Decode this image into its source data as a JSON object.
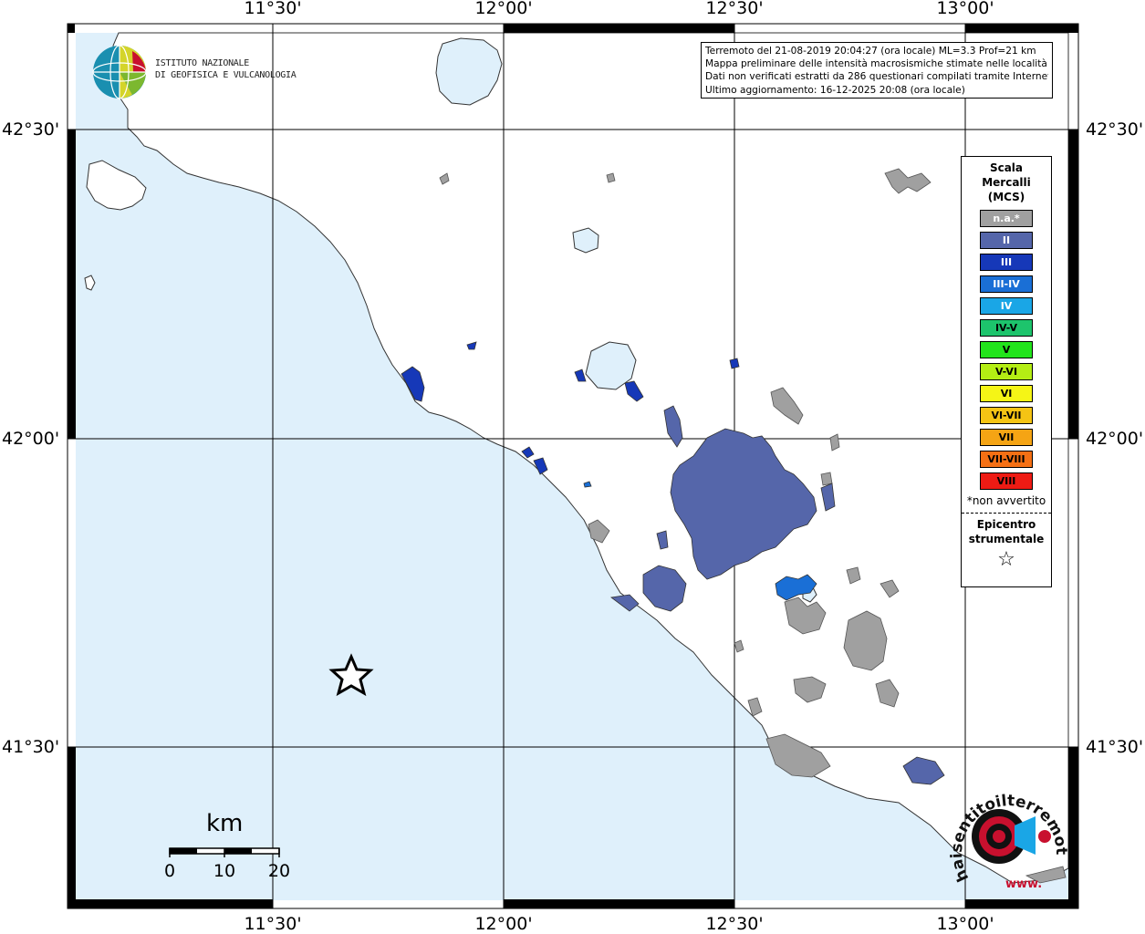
{
  "map": {
    "colors": {
      "sea": "#dff0fb",
      "land": "#ffffff",
      "coast": "#333333",
      "grid": "#000000",
      "na": "#a0a0a0",
      "II": "#5566aa"
    },
    "lon_labels": [
      "11°30'",
      "12°00'",
      "12°30'",
      "13°00'"
    ],
    "lat_labels": [
      "42°30'",
      "42°00'",
      "41°30'"
    ],
    "epicenter_icon": "star-icon"
  },
  "info": {
    "line1": "Terremoto del 21-08-2019 20:04:27 (ora locale) ML=3.3 Prof=21 km",
    "line2": "Mappa preliminare delle intensità macrosismiche stimate nelle località",
    "line3": "Dati non verificati estratti da 286 questionari compilati tramite Internet.",
    "line4": "Ultimo aggiornamento: 16-12-2025 20:08 (ora locale)"
  },
  "logo": {
    "line1": "ISTITUTO NAZIONALE",
    "line2": "DI GEOFISICA E VULCANOLOGIA"
  },
  "legend": {
    "title1": "Scala",
    "title2": "Mercalli",
    "title3": "(MCS)",
    "items": [
      {
        "label": "n.a.*",
        "color": "#a0a0a0",
        "text": "#ffffff"
      },
      {
        "label": "II",
        "color": "#5566aa",
        "text": "#ffffff"
      },
      {
        "label": "III",
        "color": "#1638b8",
        "text": "#ffffff"
      },
      {
        "label": "III-IV",
        "color": "#1a6fd6",
        "text": "#ffffff"
      },
      {
        "label": "IV",
        "color": "#1aa6e6",
        "text": "#ffffff"
      },
      {
        "label": "IV-V",
        "color": "#1dc46c",
        "text": "#000000"
      },
      {
        "label": "V",
        "color": "#22e41c",
        "text": "#000000"
      },
      {
        "label": "V-VI",
        "color": "#b4ee14",
        "text": "#000000"
      },
      {
        "label": "VI",
        "color": "#f5f516",
        "text": "#000000"
      },
      {
        "label": "VI-VII",
        "color": "#f5c414",
        "text": "#000000"
      },
      {
        "label": "VII",
        "color": "#f5a414",
        "text": "#000000"
      },
      {
        "label": "VII-VIII",
        "color": "#f57014",
        "text": "#000000"
      },
      {
        "label": "VIII",
        "color": "#ee1b14",
        "text": "#000000"
      }
    ],
    "note": "*non avvertito",
    "epi1": "Epicentro",
    "epi2": "strumentale",
    "epi_symbol": "☆"
  },
  "scale": {
    "unit": "km",
    "ticks": [
      "0",
      "10",
      "20"
    ]
  },
  "hst": {
    "text": "haisentitoilterremoto.it",
    "www": "www."
  }
}
